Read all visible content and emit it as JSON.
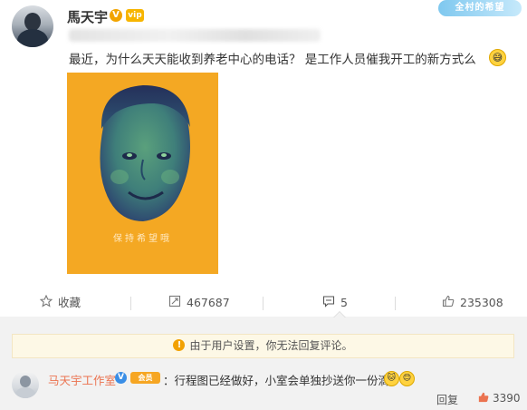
{
  "post": {
    "author": "馬天宇",
    "verified_badge": "V",
    "vip_badge": "vip",
    "watermark": "全村的希望",
    "text": "最近，为什么天天能收到养老中心的电话？ 是工作人员催我开工的新方式么",
    "text_emoji_icon": "grin-sweat-icon",
    "image_caption": "保持希望哦"
  },
  "actions": {
    "favorite": {
      "label": "收藏",
      "icon": "star-icon"
    },
    "repost": {
      "count": "467687",
      "icon": "repost-icon"
    },
    "comment": {
      "count": "5",
      "icon": "comment-icon"
    },
    "like": {
      "count": "235308",
      "icon": "thumbs-up-icon"
    }
  },
  "comments": {
    "notice": "由于用户设置，你无法回复评论。",
    "items": [
      {
        "author": "马天宇工作室",
        "verified_badge": "V",
        "member_tag": "会员",
        "text": "：行程图已经做好，小室会单独抄送你一份滴",
        "reply_label": "回复",
        "like_count": "3390"
      }
    ]
  },
  "colors": {
    "accent_orange": "#eb7350",
    "poster_bg": "#f4a823",
    "notice_bg": "#fdf8e6"
  }
}
